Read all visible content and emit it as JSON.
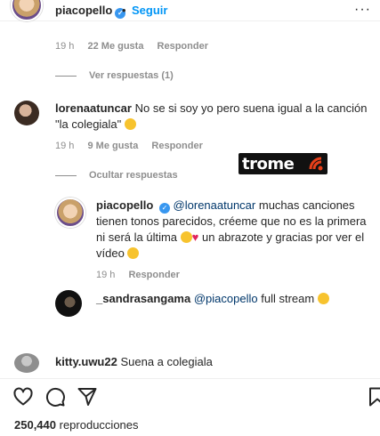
{
  "post": {
    "username": "piacopello",
    "separator": "•",
    "follow_label": "Seguir",
    "more_label": "···"
  },
  "comments": [
    {
      "meta": {
        "time": "19 h",
        "likes": "22 Me gusta",
        "reply": "Responder"
      },
      "replies_toggle": "Ver respuestas (1)"
    },
    {
      "username": "lorenaatuncar",
      "text": "No se si soy yo pero suena igual a la canción \"la colegiala\"",
      "meta": {
        "time": "19 h",
        "likes": "9 Me gusta",
        "reply": "Responder"
      },
      "replies_toggle": "Ocultar respuestas",
      "replies": [
        {
          "username": "piacopello",
          "mention": "@lorenaatuncar",
          "text_a": " muchas canciones tienen tonos parecidos, créeme que no es la primera ni será la última",
          "text_b": " un abrazote y gracias por ver el vídeo",
          "meta": {
            "time": "19 h",
            "reply": "Responder"
          }
        },
        {
          "username": "_sandrasangama",
          "mention": "@piacopello",
          "text": " full stream"
        }
      ]
    },
    {
      "username": "kitty.uwu22",
      "text": "Suena a colegiala"
    }
  ],
  "watermark": {
    "brand": "trome"
  },
  "actions": {
    "like_icon": "heart-outline-icon",
    "comment_icon": "comment-icon",
    "share_icon": "paper-plane-icon",
    "save_icon": "bookmark-icon"
  },
  "views": {
    "count": "250,440",
    "label": "reproducciones"
  },
  "colors": {
    "accent": "#0095f6",
    "verified": "#3897f0",
    "muted": "#8e8e8e",
    "heart": "#e0245e"
  }
}
